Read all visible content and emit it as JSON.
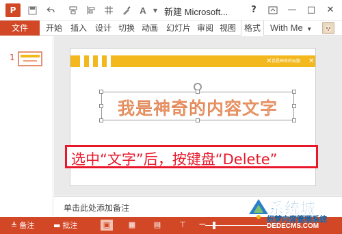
{
  "window": {
    "title": "新建 Microsoft...",
    "help": "?",
    "app_logo": "P"
  },
  "ribbon": {
    "file_tab": "文件",
    "tabs": [
      "开始",
      "插入",
      "设计",
      "切换",
      "动画",
      "幻灯片",
      "审阅",
      "视图",
      "格式"
    ],
    "user": "With Me"
  },
  "thumbnails": {
    "slide_number": "1"
  },
  "slide": {
    "main_text": "我是神奇的内容文字",
    "header_bar_text": "我是神奇的标题",
    "callout_text": "选中“文字”后，按键盘“Delete”",
    "colors": {
      "header_bar": "#f2b81e",
      "main_text": "#f3a36d",
      "callout": "#e8182a"
    }
  },
  "notes": {
    "placeholder": "单击此处添加备注"
  },
  "status": {
    "notes_label": "备注",
    "comments_label": "批注"
  },
  "watermark": {
    "big": "系统城",
    "line1": "织梦内容管理系统",
    "line2": "DEDECMS.COM"
  },
  "theme": {
    "accent": "#d24726"
  }
}
